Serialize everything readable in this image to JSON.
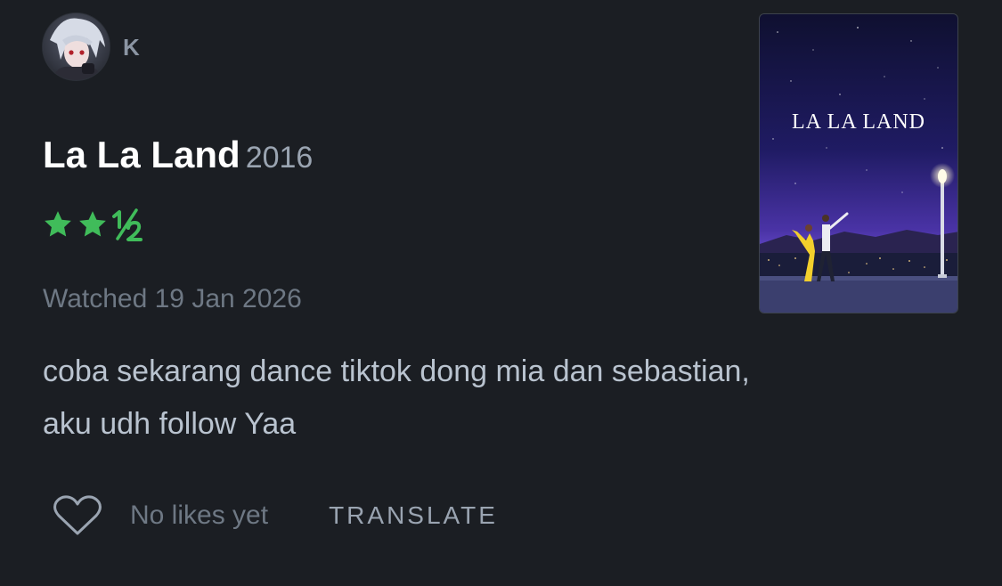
{
  "user": {
    "name": "K",
    "avatar_icon": "anime-avatar"
  },
  "film": {
    "title": "La La Land",
    "year": "2016",
    "rating_stars": 2.5,
    "rating_max": 5
  },
  "watched": "Watched 19 Jan 2026",
  "review": {
    "line1": "coba sekarang dance tiktok dong mia dan sebastian,",
    "line2": "aku udh follow Yaa"
  },
  "actions": {
    "like_icon": "heart-outline",
    "likes_text": "No likes yet",
    "translate_label": "TRANSLATE"
  },
  "poster": {
    "title_text": "LA LA LAND"
  },
  "colors": {
    "background": "#1b1e23",
    "star": "#40bc5a",
    "title": "#ffffff",
    "muted": "#6e7884"
  }
}
